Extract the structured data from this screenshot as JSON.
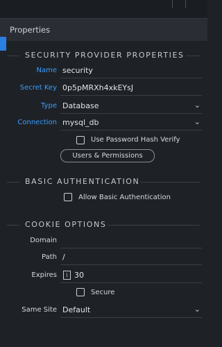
{
  "panel": {
    "title": "Properties"
  },
  "security": {
    "section_title": "SECURITY PROVIDER PROPERTIES",
    "name": {
      "label": "Name",
      "value": "security"
    },
    "secret_key": {
      "label": "Secret Key",
      "value": "0p5pMRXh4xkEYsJ"
    },
    "type": {
      "label": "Type",
      "value": "Database"
    },
    "connection": {
      "label": "Connection",
      "value": "mysql_db"
    },
    "use_password_hash": {
      "label": "Use Password Hash Verify",
      "checked": false
    },
    "users_button": "Users & Permissions"
  },
  "basic_auth": {
    "section_title": "BASIC AUTHENTICATION",
    "allow": {
      "label": "Allow Basic Authentication",
      "checked": false
    }
  },
  "cookie": {
    "section_title": "COOKIE OPTIONS",
    "domain": {
      "label": "Domain",
      "value": ""
    },
    "path": {
      "label": "Path",
      "value": "/"
    },
    "expires": {
      "label": "Expires",
      "value": "30"
    },
    "secure": {
      "label": "Secure",
      "checked": false
    },
    "same_site": {
      "label": "Same Site",
      "value": "Default"
    }
  },
  "icons": {
    "dropdown": "chevron-down-icon",
    "info": "info-icon"
  },
  "colors": {
    "accent": "#2a7fe0",
    "link_label": "#3b9cff",
    "background": "#1e2227"
  }
}
